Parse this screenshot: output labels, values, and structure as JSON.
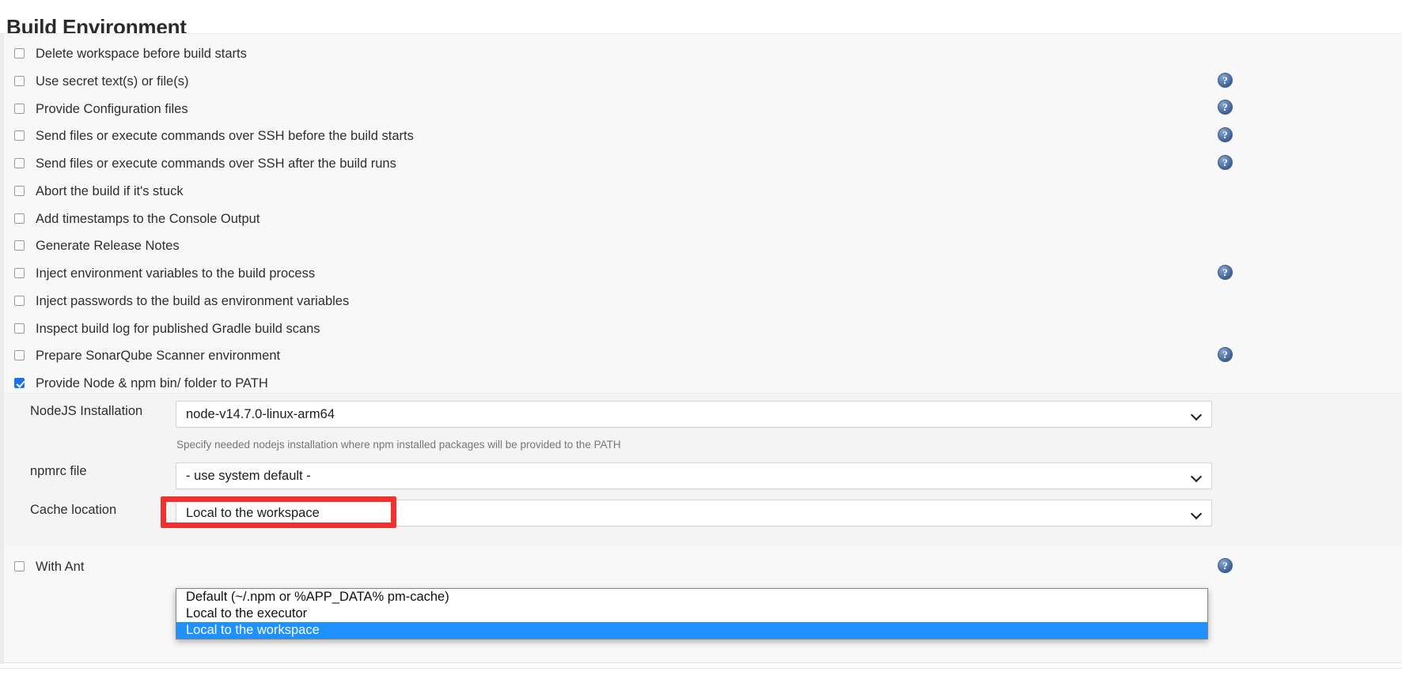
{
  "page": {
    "title": "Build Environment"
  },
  "checkboxes": [
    {
      "label": "Delete workspace before build starts",
      "checked": false,
      "help": false
    },
    {
      "label": "Use secret text(s) or file(s)",
      "checked": false,
      "help": true
    },
    {
      "label": "Provide Configuration files",
      "checked": false,
      "help": true
    },
    {
      "label": "Send files or execute commands over SSH before the build starts",
      "checked": false,
      "help": true
    },
    {
      "label": "Send files or execute commands over SSH after the build runs",
      "checked": false,
      "help": true
    },
    {
      "label": "Abort the build if it's stuck",
      "checked": false,
      "help": false
    },
    {
      "label": "Add timestamps to the Console Output",
      "checked": false,
      "help": false
    },
    {
      "label": "Generate Release Notes",
      "checked": false,
      "help": false
    },
    {
      "label": "Inject environment variables to the build process",
      "checked": false,
      "help": true
    },
    {
      "label": "Inject passwords to the build as environment variables",
      "checked": false,
      "help": false
    },
    {
      "label": "Inspect build log for published Gradle build scans",
      "checked": false,
      "help": false
    },
    {
      "label": "Prepare SonarQube Scanner environment",
      "checked": false,
      "help": true
    },
    {
      "label": "Provide Node & npm bin/ folder to PATH",
      "checked": true,
      "help": false
    }
  ],
  "node_config": {
    "nodejs_installation": {
      "label": "NodeJS Installation",
      "value": "node-v14.7.0-linux-arm64",
      "description": "Specify needed nodejs installation where npm installed packages will be provided to the PATH"
    },
    "npmrc_file": {
      "label": "npmrc file",
      "value": "- use system default -"
    },
    "cache_location": {
      "label": "Cache location",
      "value": "Local to the workspace",
      "options": [
        "Default (~/.npm or %APP_DATA% pm-cache)",
        "Local to the executor",
        "Local to the workspace"
      ],
      "selected_index": 2
    }
  },
  "with_ant": {
    "label": "With Ant",
    "checked": false,
    "help": true
  },
  "icons": {
    "help": "?",
    "chevron_down": "chevron-down-icon"
  },
  "colors": {
    "accent_blue": "#1a73e8",
    "highlight_blue": "#1e90ff",
    "annotation_red": "#f33030",
    "panel_bg": "#f8f8f8",
    "nested_bg": "#f4f4f4"
  }
}
